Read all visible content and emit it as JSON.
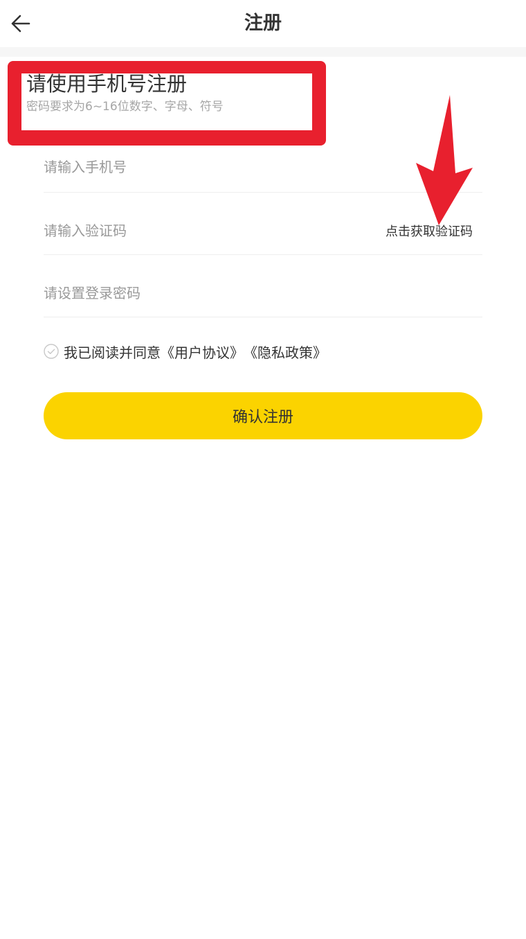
{
  "header": {
    "back_icon": "arrow-left-icon",
    "title": "注册"
  },
  "intro": {
    "title": "请使用手机号注册",
    "subtitle": "密码要求为6~16位数字、字母、符号",
    "highlight_color": "#e8202e"
  },
  "form": {
    "phone_placeholder": "请输入手机号",
    "code_placeholder": "请输入验证码",
    "get_code_label": "点击获取验证码",
    "password_placeholder": "请设置登录密码"
  },
  "agreement": {
    "checked": true,
    "check_icon": "check-circle-icon",
    "prefix": "我已阅读并同意",
    "user_agreement": "《用户协议》",
    "privacy_policy": "《隐私政策》"
  },
  "submit": {
    "label": "确认注册",
    "color": "#fbd300"
  },
  "annotation": {
    "arrow_icon": "red-arrow-down-icon",
    "color": "#e8202e"
  }
}
